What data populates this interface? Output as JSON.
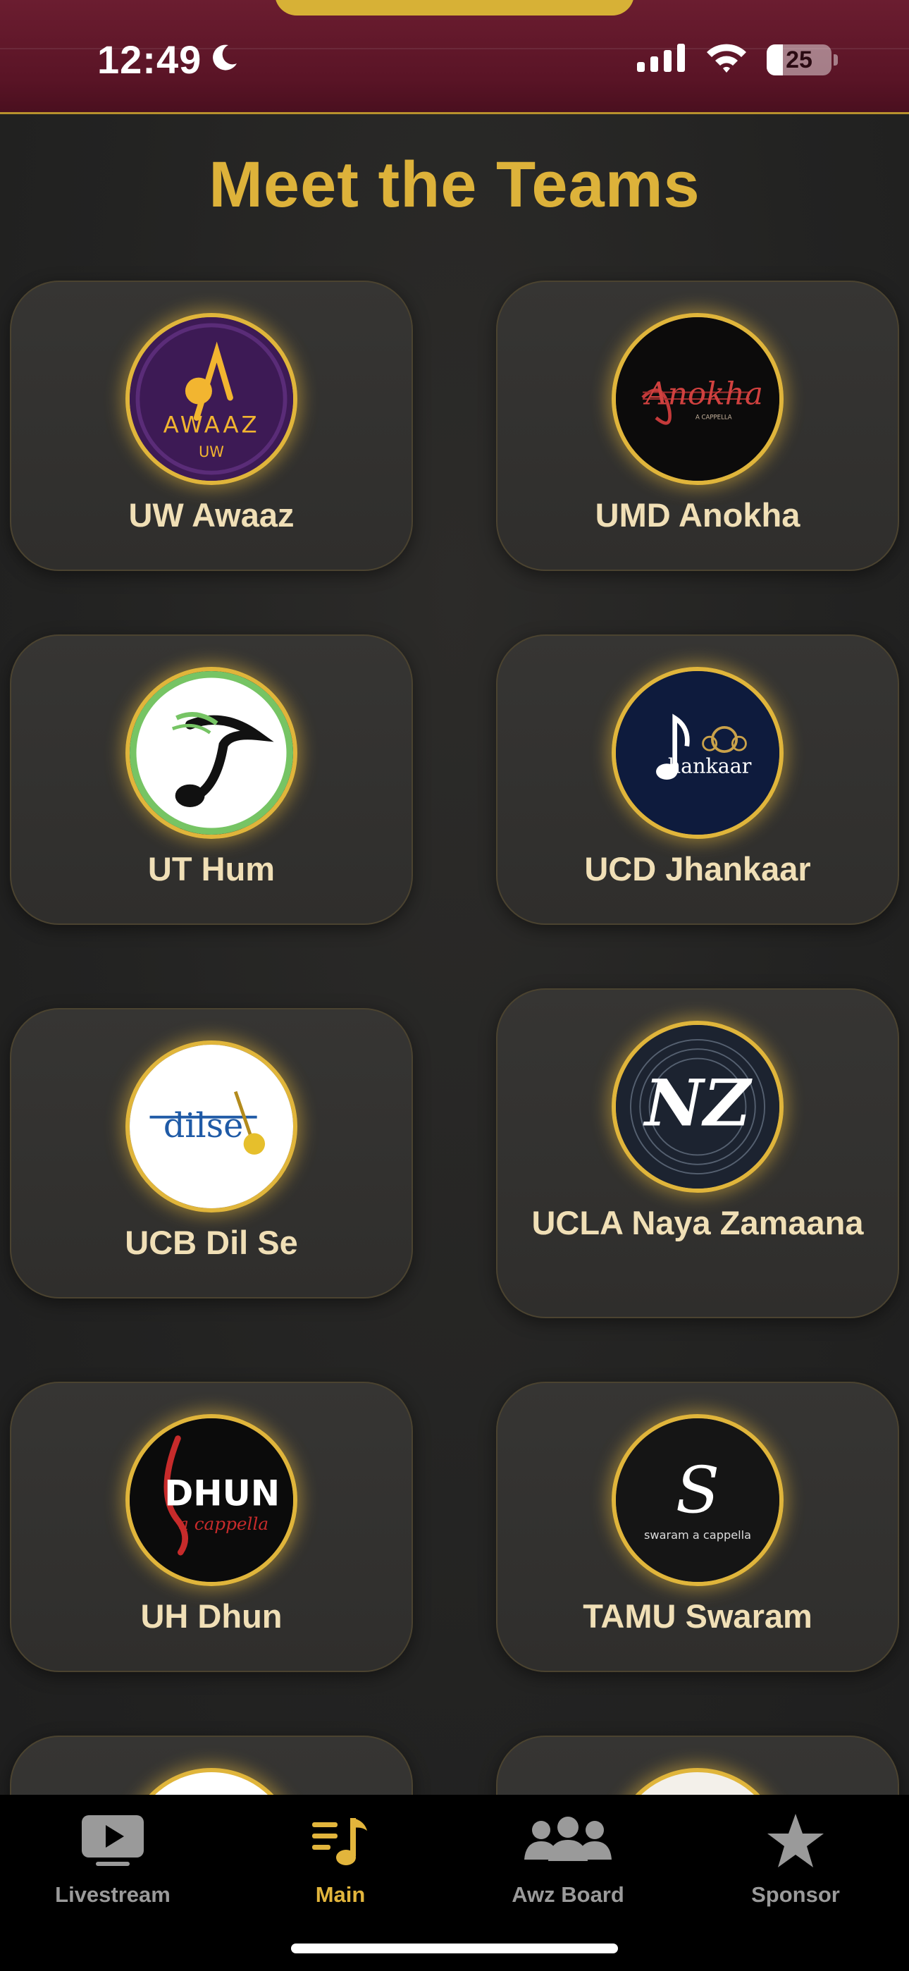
{
  "status_bar": {
    "time": "12:49",
    "battery": "25"
  },
  "page": {
    "title": "Meet the Teams"
  },
  "teams": [
    {
      "name": "UW Awaaz",
      "logo_text": "AWAAZ",
      "logo_sub": "UW"
    },
    {
      "name": "UMD Anokha",
      "logo_text": "Anokha",
      "logo_sub": "A CAPPELLA"
    },
    {
      "name": "UT Hum"
    },
    {
      "name": "UCD Jhankaar",
      "logo_text": "hankaar"
    },
    {
      "name": "UCB Dil Se",
      "logo_text": "dilse"
    },
    {
      "name": "UCLA Naya Zamaana",
      "logo_text": "NZ"
    },
    {
      "name": "UH Dhun",
      "logo_text": "DHUN",
      "logo_sub": "a cappella"
    },
    {
      "name": "TAMU Swaram",
      "logo_text": "S",
      "logo_sub": "swaram a cappella"
    }
  ],
  "tabs": [
    {
      "label": "Livestream",
      "icon": "play-icon",
      "active": false
    },
    {
      "label": "Main",
      "icon": "music-note-icon",
      "active": true
    },
    {
      "label": "Awz Board",
      "icon": "people-icon",
      "active": false
    },
    {
      "label": "Sponsor",
      "icon": "star-icon",
      "active": false
    }
  ],
  "colors": {
    "accent": "#ddb23a",
    "header": "#5a1426",
    "card": "#333230",
    "tab_inactive": "#9a9a9a"
  }
}
